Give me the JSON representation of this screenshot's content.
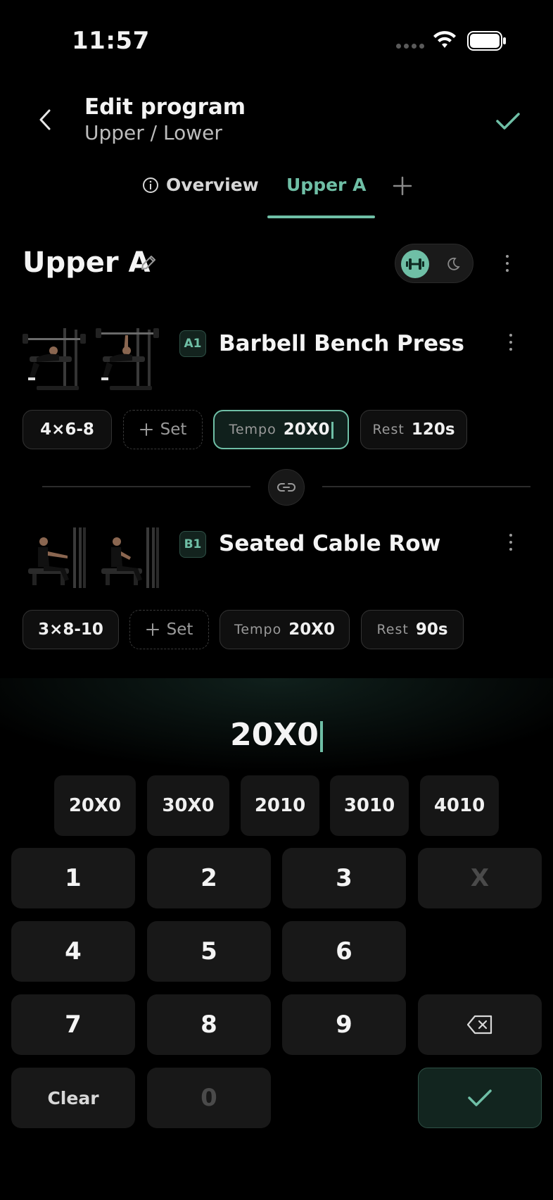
{
  "status": {
    "time": "11:57"
  },
  "header": {
    "title": "Edit program",
    "subtitle": "Upper / Lower"
  },
  "tabs": [
    {
      "label": "Overview",
      "active": false
    },
    {
      "label": "Upper A",
      "active": true
    }
  ],
  "day": {
    "title": "Upper A"
  },
  "exercises": [
    {
      "badge": "A1",
      "name": "Barbell Bench Press",
      "sets": "4×6-8",
      "add_set": "Set",
      "tempo_label": "Tempo",
      "tempo_value": "20X0",
      "rest_label": "Rest",
      "rest_value": "120s"
    },
    {
      "badge": "B1",
      "name": "Seated Cable Row",
      "sets": "3×8-10",
      "add_set": "Set",
      "tempo_label": "Tempo",
      "tempo_value": "20X0",
      "rest_label": "Rest",
      "rest_value": "90s"
    }
  ],
  "keypad": {
    "entry_value": "20X0",
    "presets": [
      "20X0",
      "30X0",
      "2010",
      "3010",
      "4010"
    ],
    "keys": {
      "k1": "1",
      "k2": "2",
      "k3": "3",
      "kx": "X",
      "k4": "4",
      "k5": "5",
      "k6": "6",
      "k7": "7",
      "k8": "8",
      "k9": "9",
      "clear": "Clear",
      "k0": "0"
    }
  },
  "colors": {
    "accent": "#6fbfa6",
    "background": "#000000"
  }
}
